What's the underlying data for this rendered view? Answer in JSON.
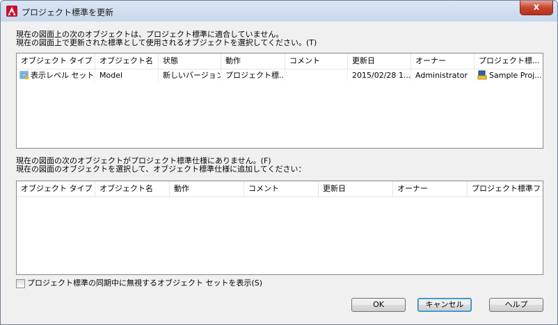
{
  "window": {
    "title": "プロジェクト標準を更新",
    "close_label": "x"
  },
  "section1": {
    "line1": "現在の図面上の次のオブジェクトは、プロジェクト標準に適合していません。",
    "line2": "現在の図面上で更新された標準として使用されるオブジェクトを選択してください。(T)",
    "columns": [
      "オブジェクト タイプ",
      "オブジェクト名",
      "状態",
      "動作",
      "コメント",
      "更新日",
      "オーナー",
      "プロジェクト標..."
    ],
    "rows": [
      {
        "type": "表示レベル セット",
        "name": "Model",
        "state": "新しいバージョン",
        "action": "プロジェクト標...",
        "comment": "",
        "updated": "2015/02/28 1...",
        "owner": "Administrator",
        "project": "Sample Proj..."
      }
    ]
  },
  "section2": {
    "line1": "現在の図面の次のオブジェクトがプロジェクト標準仕様にありません。(F)",
    "line2": "現在の図面のオブジェクトを選択して、オブジェクト標準仕様に追加してください：",
    "columns": [
      "オブジェクト タイプ",
      "オブジェクト名",
      "動作",
      "コメント",
      "更新日",
      "オーナー",
      "プロジェクト標準フ..."
    ]
  },
  "option": {
    "label": "プロジェクト標準の同期中に無視するオブジェクト セットを表示(S)",
    "checked": false
  },
  "buttons": {
    "ok": "OK",
    "cancel": "キャンセル",
    "help": "ヘルプ"
  },
  "colors": {
    "titlebar": "#c7d7ec",
    "close": "#c7452f",
    "dialog_bg": "#f0f0f0"
  }
}
